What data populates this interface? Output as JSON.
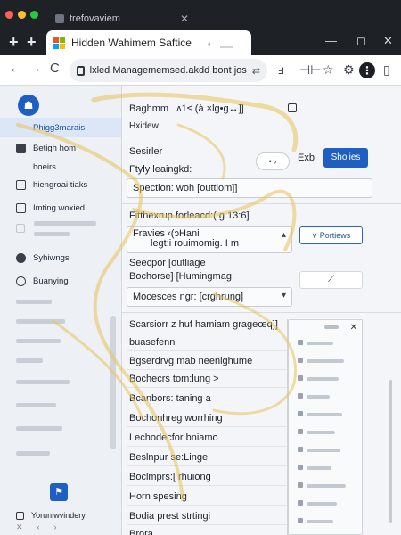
{
  "browser": {
    "tab1_title": "trefovaviem",
    "tab2_title": "Hidden Wahimem Saftice",
    "address": "lxled Managememsed.akdd bont jos",
    "colors": {
      "close": "#ff5f57",
      "minimize": "#ffbd2e",
      "maximize": "#28c840",
      "brand_blue": "#1f5fc1"
    }
  },
  "sidebar": {
    "items": [
      {
        "label": "Phigg3marais",
        "icon": "none-icon"
      },
      {
        "label": "Betigh hom",
        "icon": "grid-icon"
      },
      {
        "label": "hoeirs",
        "icon": "none-icon"
      },
      {
        "label": "hiengroai tiaks",
        "icon": "bookmark-icon"
      },
      {
        "label": "Imting woxied",
        "icon": "bookmark-icon"
      },
      {
        "label": "Syhiwngs",
        "icon": "circle-icon"
      },
      {
        "label": "Buanying",
        "icon": "circle-icon"
      }
    ],
    "footer_label": "Yoruniwvindery"
  },
  "main": {
    "header": "Baghmm",
    "header_code": "ʌ1≤ (à ×lg•g↔]]",
    "subheader": "Hxidew",
    "row_seserler": "Sesirler",
    "row_fity": "Ftyly leaingkd:",
    "chip_label": "• ›",
    "exb_label": "Exb",
    "primary_button": "Sholies",
    "field_spection": "Spection: woh [outtiom]]",
    "field_fithexrup": "Fitthexrup forleacd:( g 13:6]",
    "field_fravies": "Fravies ‹(ɔHani",
    "field_fravies_sub": "legt:i rouimomig. I m",
    "outline_button": "Portiews",
    "row_seecpor": "Seecpor [outliage",
    "row_bochorse": "Bochorse] [Humingmag:",
    "field_mocesces": "Mocesces ngr: [crghrung]",
    "pin_label": "⟋",
    "list_header": "Scarsiorr z huf hamiam grageœq]]",
    "list": [
      "buasefenn",
      "Bgserdrvg mab neenighume",
      "Bochecrs tom:lung >",
      "Bcanbors: taning a",
      "Bochonhreg worrhing",
      "Lechodecfor bniamo",
      "Beslnpur se:Linge",
      "Boclmprs:[ rhuiong",
      "Horn spesing",
      "Bodia prest strtingi",
      "Brora"
    ]
  }
}
